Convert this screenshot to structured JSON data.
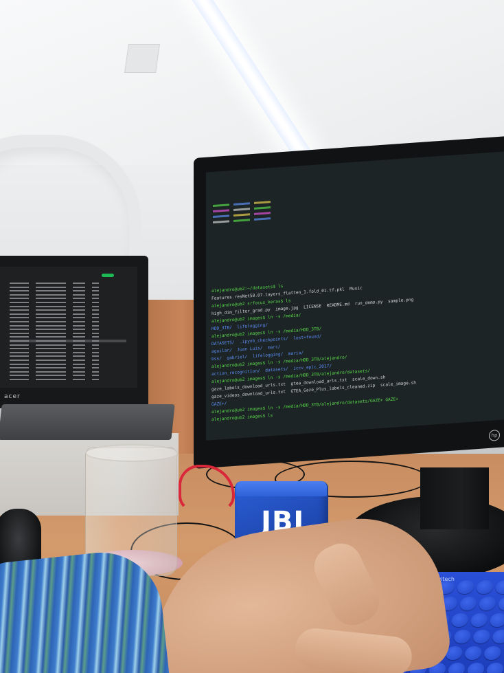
{
  "scene": {
    "description_tags": [
      "desk",
      "monitor",
      "laptop",
      "terminal",
      "glass",
      "speaker",
      "keyboard",
      "hand"
    ]
  },
  "laptop": {
    "brand": "acer"
  },
  "monitor": {
    "brand": "hp",
    "terminal_lines": [
      "alejandro@ub2:~/datasets$ ls",
      "Features.resNet50.07.layers_flatten_1.fold_01.tf.pkl  Music",
      "alejandro@ub2 srfocus_keras$ ls",
      "high_dim_filter_grad.py  image.jpg  LICENSE  README.md  run_demo.py  sample.png",
      "alejandro@ub2 images$ ln -s /media/",
      "HDD_3TB/  lifelogging/",
      "alejandro@ub2 images$ ln -s /media/HDD_3TB/",
      "DATASETS/  .ipynb_checkpoints/  lost+found/",
      "aguilar/  Juan Luis/  marc/",
      "bss/  gabriel/  lifelogging/  maria/",
      "alejandro@ub2 images$ ln -s /media/HDD_3TB/alejandro/",
      "action_recognition/  datasets/  iccv_epic_2017/",
      "alejandro@ub2 images$ ln -s /media/HDD_3TB/alejandro/datasets/",
      "gaze_labels_download_urls.txt  gtea_download_urls.txt  scale_down.sh",
      "gaze_videos_download_urls.txt  GTEA_Gaze_Plus_labels_cleaned.zip  scale_image.sh",
      "GAZE+/",
      "alejandro@ub2 images$ ln -s /media/HDD_3TB/alejandro/datasets/GAZE+ GAZE+",
      "alejandro@ub2 images$ ls"
    ]
  },
  "speaker": {
    "brand": "JBL"
  },
  "keyboard": {
    "brand": "logitech"
  }
}
